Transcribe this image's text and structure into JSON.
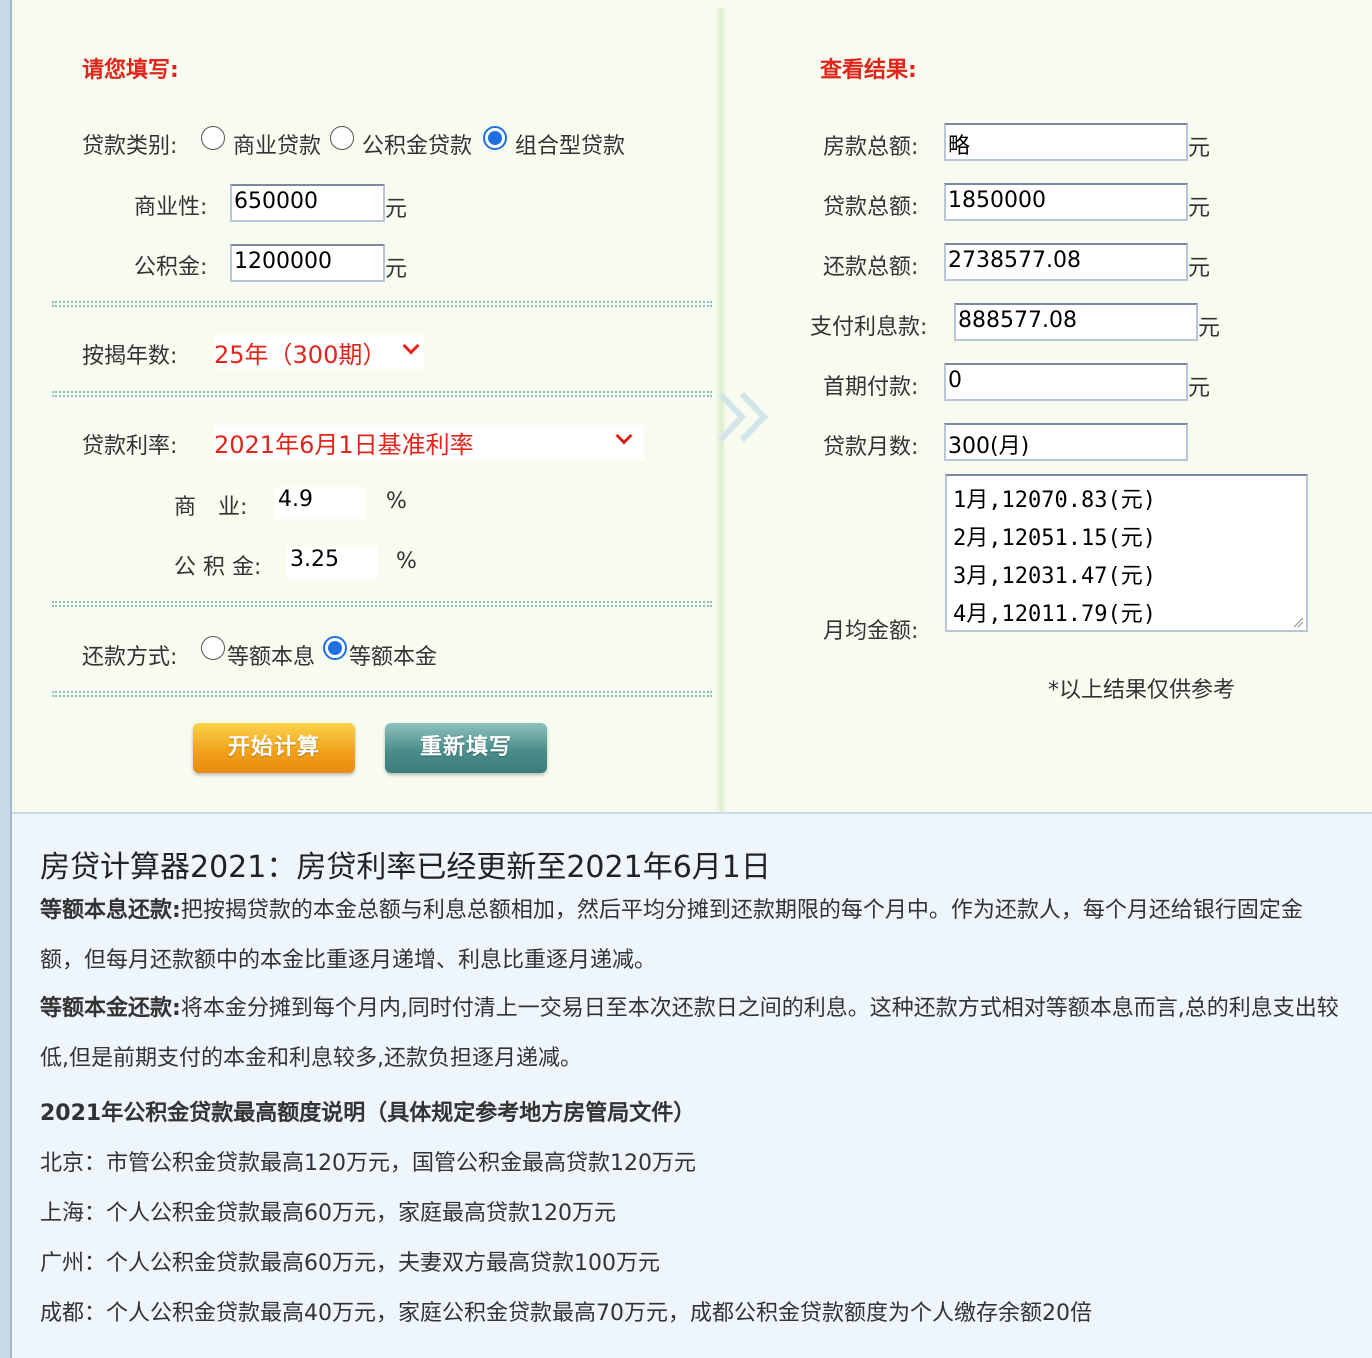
{
  "left": {
    "heading": "请您填写:",
    "loan_type_label": "贷款类别:",
    "loan_types": [
      "商业贷款",
      "公积金贷款",
      "组合型贷款"
    ],
    "selected_loan_type": "组合型贷款",
    "commercial_label": "商业性:",
    "commercial_value": "650000",
    "fund_label": "公积金:",
    "fund_value": "1200000",
    "unit": "元",
    "years_label": "按揭年数:",
    "years_value": "25年（300期）",
    "rate_label": "贷款利率:",
    "rate_value": "2021年6月1日基准利率",
    "commercial_rate_label": "商　业:",
    "commercial_rate": "4.9",
    "fund_rate_label": "公 积 金:",
    "fund_rate": "3.25",
    "percent": "%",
    "method_label": "还款方式:",
    "methods": [
      "等额本息",
      "等额本金"
    ],
    "selected_method": "等额本金",
    "calc_button": "开始计算",
    "reset_button": "重新填写"
  },
  "right": {
    "heading": "查看结果:",
    "house_total_label": "房款总额:",
    "house_total": "略",
    "loan_total_label": "贷款总额:",
    "loan_total": "1850000",
    "repay_total_label": "还款总额:",
    "repay_total": "2738577.08",
    "interest_label": "支付利息款:",
    "interest": "888577.08",
    "down_payment_label": "首期付款:",
    "down_payment": "0",
    "months_label": "贷款月数:",
    "months": "300(月)",
    "monthly_label": "月均金额:",
    "monthly_lines": [
      "1月,12070.83(元)",
      "2月,12051.15(元)",
      "3月,12031.47(元)",
      "4月,12011.79(元)"
    ],
    "unit": "元",
    "note": "*以上结果仅供参考"
  },
  "info": {
    "title": "房贷计算器2021：房贷利率已经更新至2021年6月1日",
    "p1_bold": "等额本息还款:",
    "p1_text": "把按揭贷款的本金总额与利息总额相加，然后平均分摊到还款期限的每个月中。作为还款人，每个月还给银行固定金额，但每月还款额中的本金比重逐月递增、利息比重逐月递减。",
    "p2_bold": "等额本金还款:",
    "p2_text": "将本金分摊到每个月内,同时付清上一交易日至本次还款日之间的利息。这种还款方式相对等额本息而言,总的利息支出较低,但是前期支付的本金和利息较多,还款负担逐月递减。",
    "p3_bold": "2021年公积金贷款最高额度说明（具体规定参考地方房管局文件）",
    "lines": [
      "北京：市管公积金贷款最高120万元，国管公积金最高贷款120万元",
      "上海：个人公积金贷款最高60万元，家庭最高贷款120万元",
      "广州：个人公积金贷款最高60万元，夫妻双方最高贷款100万元",
      "成都：个人公积金贷款最高40万元，家庭公积金贷款最高70万元，成都公积金贷款额度为个人缴存余额20倍"
    ]
  }
}
